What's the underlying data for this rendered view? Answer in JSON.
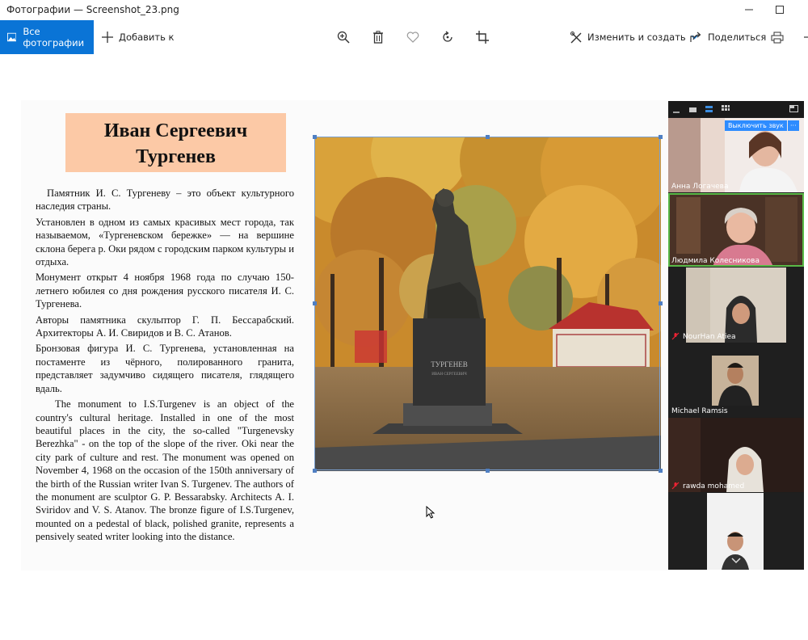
{
  "window": {
    "title": "Фотографии — Screenshot_23.png",
    "minimize": "—",
    "maximize": "☐"
  },
  "toolbar": {
    "all_photos": "Все фотографии",
    "add_to": "Добавить к",
    "edit_create": "Изменить и создать",
    "share": "Поделиться"
  },
  "slide": {
    "title_line1": "Иван Сергеевич",
    "title_line2": "Тургенев",
    "paragraphs_ru": [
      "Памятник И. С. Тургеневу – это объект культурного наследия страны.",
      "Установлен в одном из самых красивых мест города, так называемом, «Тургеневском бережке» — на вершине склона берега р. Оки рядом с городским парком культуры и отдыха.",
      "Монумент открыт 4 ноября 1968 года по случаю 150-летнего юбилея со дня рождения русского писателя И. С. Тургенева.",
      "Авторы памятника скульптор Г. П. Бессарабский. Архитекторы А. И. Свиридов и В. С. Атанов.",
      "Бронзовая фигура И. С. Тургенева, установленная на постаменте из чёрного, полированного гранита, представляет задумчиво сидящего писателя, глядящего вдаль."
    ],
    "paragraph_en": "The monument to I.S.Turgenev is an object of the country's cultural heritage. Installed in one of the most beautiful places in the city, the so-called \"Turgenevsky Berezhka\" - on the top of the slope of the river. Oki near the city park of culture and rest. The monument was opened on November 4, 1968 on the occasion of the 150th anniversary of the birth of the Russian writer Ivan S. Turgenev. The authors of the monument are sculptor G. P. Bessarabsky. Architects A. I. Sviridov and V. S. Atanov. The bronze figure of I.S.Turgenev, mounted on a pedestal of black, polished granite, represents a pensively seated writer looking into the distance.",
    "pedestal_text_1": "ТУРГЕНЕВ",
    "pedestal_text_2": "ИВАН СЕРГЕЕВИЧ"
  },
  "zoom": {
    "mute_button": "Выключить звук",
    "more": "···",
    "participants": [
      {
        "name": "Анна Логачева",
        "muted": false
      },
      {
        "name": "Людмила Колесникова",
        "muted": false
      },
      {
        "name": "NourHan Atiea",
        "muted": true
      },
      {
        "name": "Michael Ramsis",
        "muted": false
      },
      {
        "name": "rawda mohamed",
        "muted": true
      },
      {
        "name": "",
        "muted": false
      }
    ]
  },
  "colors": {
    "accent": "#0a74d6",
    "title_box": "#fcc9a6",
    "speaker_highlight": "#58b847"
  }
}
